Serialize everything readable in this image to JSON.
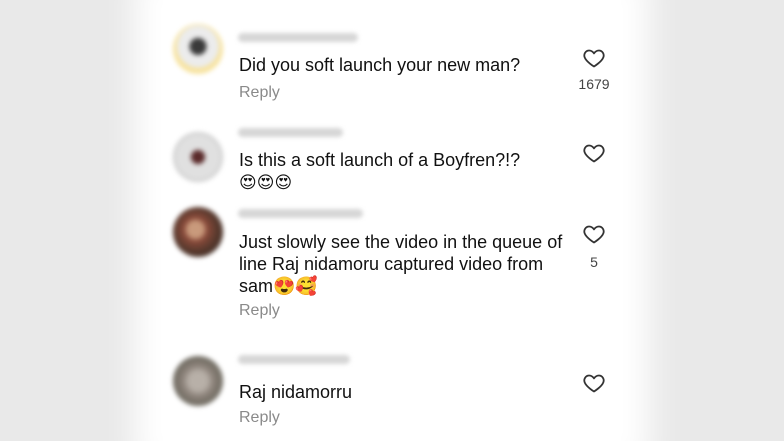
{
  "comments": [
    {
      "text": "Did you soft launch your new man?",
      "reply_label": "Reply",
      "likes": "1679",
      "username_blurred": true
    },
    {
      "text": "Is this a soft launch of a Boyfren?!?",
      "emoji_line": "😍😍😍",
      "username_blurred": true
    },
    {
      "text": "Just slowly see the video in the queue of line Raj nidamoru captured video from sam😍🥰",
      "reply_label": "Reply",
      "likes": "5",
      "username_blurred": true
    },
    {
      "text": "Raj nidamorru",
      "reply_label": "Reply",
      "username_blurred": true
    }
  ],
  "icons": {
    "like": "heart-outline-icon"
  },
  "colors": {
    "text": "#111111",
    "reply": "#8a8a8a",
    "background": "#ffffff"
  }
}
